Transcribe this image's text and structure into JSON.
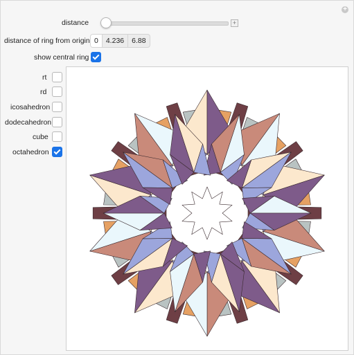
{
  "controls": {
    "distance_label": "distance",
    "distance_value": 0,
    "ring_distance_label": "distance of ring from origin",
    "ring_distance_options": [
      "0",
      "4.236",
      "6.88"
    ],
    "show_ring_label": "show central ring",
    "show_ring_checked": true
  },
  "toggles": [
    {
      "label": "rt",
      "checked": false
    },
    {
      "label": "rd",
      "checked": false
    },
    {
      "label": "icosahedron",
      "checked": false
    },
    {
      "label": "dodecahedron",
      "checked": false
    },
    {
      "label": "cube",
      "checked": false
    },
    {
      "label": "octahedron",
      "checked": true
    }
  ],
  "colors": {
    "face_peach": "#fce8cd",
    "face_salmon": "#c98a7a",
    "face_blue": "#9ca6dc",
    "face_purple": "#7e5b8a",
    "face_ice": "#eaf7fc",
    "face_orange": "#e6a163",
    "face_grey": "#b9c3c2",
    "face_dark": "#6e3f45",
    "accent": "#1a73e8"
  }
}
